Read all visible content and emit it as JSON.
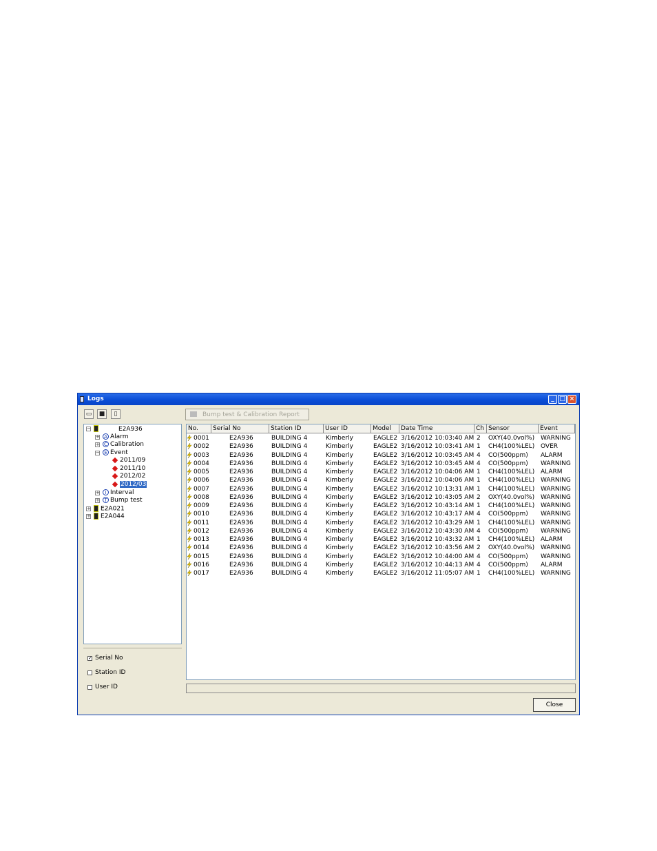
{
  "window": {
    "title": "Logs",
    "minimize_icon": "minimize-icon",
    "maximize_icon": "maximize-icon",
    "close_icon": "close-icon"
  },
  "toolbar": {
    "print_icon": "printer-icon",
    "save_icon": "floppy-disk-icon",
    "clipboard_icon": "clipboard-icon",
    "report_button": "Bump test & Calibration Report"
  },
  "tree": {
    "root": "E2A936",
    "alarm": "Alarm",
    "calibration": "Calibration",
    "event": "Event",
    "event_dates": [
      "2011/09",
      "2011/10",
      "2012/02",
      "2012/03"
    ],
    "interval": "Interval",
    "bump_test": "Bump test",
    "other_devices": [
      "E2A021",
      "E2A044"
    ],
    "letters": {
      "alarm": "A",
      "calibration": "C",
      "event": "E",
      "interval": "I",
      "bump_test": "T"
    }
  },
  "filters": {
    "serial_no": {
      "label": "Serial No",
      "checked": true
    },
    "station_id": {
      "label": "Station ID",
      "checked": false
    },
    "user_id": {
      "label": "User ID",
      "checked": false
    }
  },
  "table": {
    "columns": [
      "No.",
      "Serial No",
      "Station ID",
      "User ID",
      "Model",
      "Date Time",
      "Ch",
      "Sensor",
      "Event"
    ],
    "rows": [
      [
        "0001",
        "E2A936",
        "BUILDING 4",
        "Kimberly",
        "EAGLE2",
        "3/16/2012 10:03:40 AM",
        "2",
        "OXY(40.0vol%)",
        "WARNING"
      ],
      [
        "0002",
        "E2A936",
        "BUILDING 4",
        "Kimberly",
        "EAGLE2",
        "3/16/2012 10:03:41 AM",
        "1",
        "CH4(100%LEL)",
        "OVER"
      ],
      [
        "0003",
        "E2A936",
        "BUILDING 4",
        "Kimberly",
        "EAGLE2",
        "3/16/2012 10:03:45 AM",
        "4",
        "CO(500ppm)",
        "ALARM"
      ],
      [
        "0004",
        "E2A936",
        "BUILDING 4",
        "Kimberly",
        "EAGLE2",
        "3/16/2012 10:03:45 AM",
        "4",
        "CO(500ppm)",
        "WARNING"
      ],
      [
        "0005",
        "E2A936",
        "BUILDING 4",
        "Kimberly",
        "EAGLE2",
        "3/16/2012 10:04:06 AM",
        "1",
        "CH4(100%LEL)",
        "ALARM"
      ],
      [
        "0006",
        "E2A936",
        "BUILDING 4",
        "Kimberly",
        "EAGLE2",
        "3/16/2012 10:04:06 AM",
        "1",
        "CH4(100%LEL)",
        "WARNING"
      ],
      [
        "0007",
        "E2A936",
        "BUILDING 4",
        "Kimberly",
        "EAGLE2",
        "3/16/2012 10:13:31 AM",
        "1",
        "CH4(100%LEL)",
        "WARNING"
      ],
      [
        "0008",
        "E2A936",
        "BUILDING 4",
        "Kimberly",
        "EAGLE2",
        "3/16/2012 10:43:05 AM",
        "2",
        "OXY(40.0vol%)",
        "WARNING"
      ],
      [
        "0009",
        "E2A936",
        "BUILDING 4",
        "Kimberly",
        "EAGLE2",
        "3/16/2012 10:43:14 AM",
        "1",
        "CH4(100%LEL)",
        "WARNING"
      ],
      [
        "0010",
        "E2A936",
        "BUILDING 4",
        "Kimberly",
        "EAGLE2",
        "3/16/2012 10:43:17 AM",
        "4",
        "CO(500ppm)",
        "WARNING"
      ],
      [
        "0011",
        "E2A936",
        "BUILDING 4",
        "Kimberly",
        "EAGLE2",
        "3/16/2012 10:43:29 AM",
        "1",
        "CH4(100%LEL)",
        "WARNING"
      ],
      [
        "0012",
        "E2A936",
        "BUILDING 4",
        "Kimberly",
        "EAGLE2",
        "3/16/2012 10:43:30 AM",
        "4",
        "CO(500ppm)",
        "WARNING"
      ],
      [
        "0013",
        "E2A936",
        "BUILDING 4",
        "Kimberly",
        "EAGLE2",
        "3/16/2012 10:43:32 AM",
        "1",
        "CH4(100%LEL)",
        "ALARM"
      ],
      [
        "0014",
        "E2A936",
        "BUILDING 4",
        "Kimberly",
        "EAGLE2",
        "3/16/2012 10:43:56 AM",
        "2",
        "OXY(40.0vol%)",
        "WARNING"
      ],
      [
        "0015",
        "E2A936",
        "BUILDING 4",
        "Kimberly",
        "EAGLE2",
        "3/16/2012 10:44:00 AM",
        "4",
        "CO(500ppm)",
        "WARNING"
      ],
      [
        "0016",
        "E2A936",
        "BUILDING 4",
        "Kimberly",
        "EAGLE2",
        "3/16/2012 10:44:13 AM",
        "4",
        "CO(500ppm)",
        "ALARM"
      ],
      [
        "0017",
        "E2A936",
        "BUILDING 4",
        "Kimberly",
        "EAGLE2",
        "3/16/2012 11:05:07 AM",
        "1",
        "CH4(100%LEL)",
        "WARNING"
      ]
    ]
  },
  "footer": {
    "close_button": "Close"
  }
}
